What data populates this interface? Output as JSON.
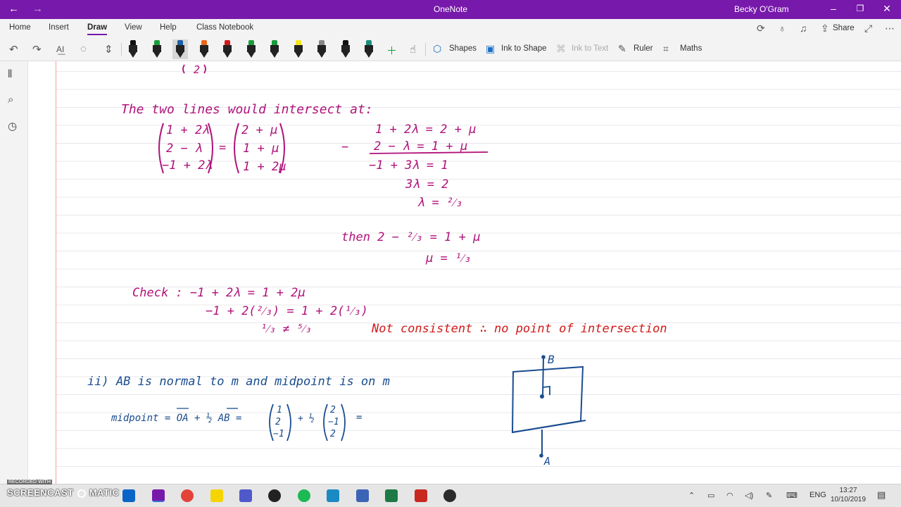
{
  "window": {
    "title": "OneNote",
    "user": "Becky O'Gram",
    "back_icon": "back-arrow-icon",
    "forward_icon": "forward-arrow-icon",
    "titlebar_color": "#7719aa"
  },
  "ribbon": {
    "tabs": [
      {
        "label": "Home"
      },
      {
        "label": "Insert"
      },
      {
        "label": "Draw",
        "active": true
      },
      {
        "label": "View"
      },
      {
        "label": "Help"
      },
      {
        "label": "Class Notebook"
      }
    ],
    "share_label": "Share"
  },
  "toolbar": {
    "pens": [
      {
        "name": "pen-black-1",
        "color": "#111111"
      },
      {
        "name": "pen-green-1",
        "color": "#1a9e3a"
      },
      {
        "name": "pen-blue",
        "color": "#1a5fa8",
        "selected": true
      },
      {
        "name": "pen-orange",
        "color": "#e8671a"
      },
      {
        "name": "pen-red",
        "color": "#d11a1a"
      },
      {
        "name": "pen-green-2",
        "color": "#1a9e3a"
      },
      {
        "name": "pen-green-3",
        "color": "#1a9e3a"
      },
      {
        "name": "highlighter-yellow",
        "color": "#f5e61a"
      },
      {
        "name": "pen-gray",
        "color": "#888888"
      },
      {
        "name": "pen-black-2",
        "color": "#111111"
      },
      {
        "name": "pen-teal",
        "color": "#1a8e7e"
      }
    ],
    "shapes_label": "Shapes",
    "ink_to_shape_label": "Ink to Shape",
    "ink_to_text_label": "Ink to Text",
    "ruler_label": "Ruler",
    "maths_label": "Maths"
  },
  "ink": {
    "intersect_heading": "The two lines would intersect at:",
    "eq_left_1": "1 + 2λ",
    "eq_left_2": "2 − λ",
    "eq_left_3": "−1 + 2λ",
    "eq_right_1": "2 + μ",
    "eq_right_2": "1 + μ",
    "eq_right_3": "1 + 2μ",
    "minus_sign": "−",
    "work_1": "1 + 2λ = 2 + μ",
    "work_2": "2 − λ = 1 + μ",
    "work_3": "−1 + 3λ = 1",
    "work_4": "3λ = 2",
    "work_5": "λ = ²⁄₃",
    "then_1": "then   2 − ²⁄₃ = 1 + μ",
    "then_2": "μ = ¹⁄₃",
    "check_1": "Check :  −1 + 2λ = 1 + 2μ",
    "check_2": "−1 + 2(²⁄₃) = 1 + 2(¹⁄₃)",
    "check_3": "¹⁄₃ ≠ ⁵⁄₃",
    "not_consistent": "Not consistent ∴ no point of intersection",
    "part_ii": "ii)   AB is normal to m  and midpoint is on m",
    "midpoint_label": "midpoint = OA + ½ AB =",
    "mid_vec_1": [
      "1",
      "2",
      "−1"
    ],
    "mid_vec_2": [
      "2",
      "−1",
      "2"
    ],
    "equals": "=",
    "plus_half": "+ ½",
    "diagram_b": "B",
    "diagram_a": "A",
    "ink_purple": "#b0127a",
    "ink_red": "#d11a1a",
    "ink_blue": "#1a4d8f"
  },
  "taskbar": {
    "recorded_with": "RECORDED WITH",
    "screencast": "SCREENCAST",
    "matic": "MATIC",
    "lang": "ENG",
    "time": "13:27",
    "date": "10/10/2019"
  }
}
